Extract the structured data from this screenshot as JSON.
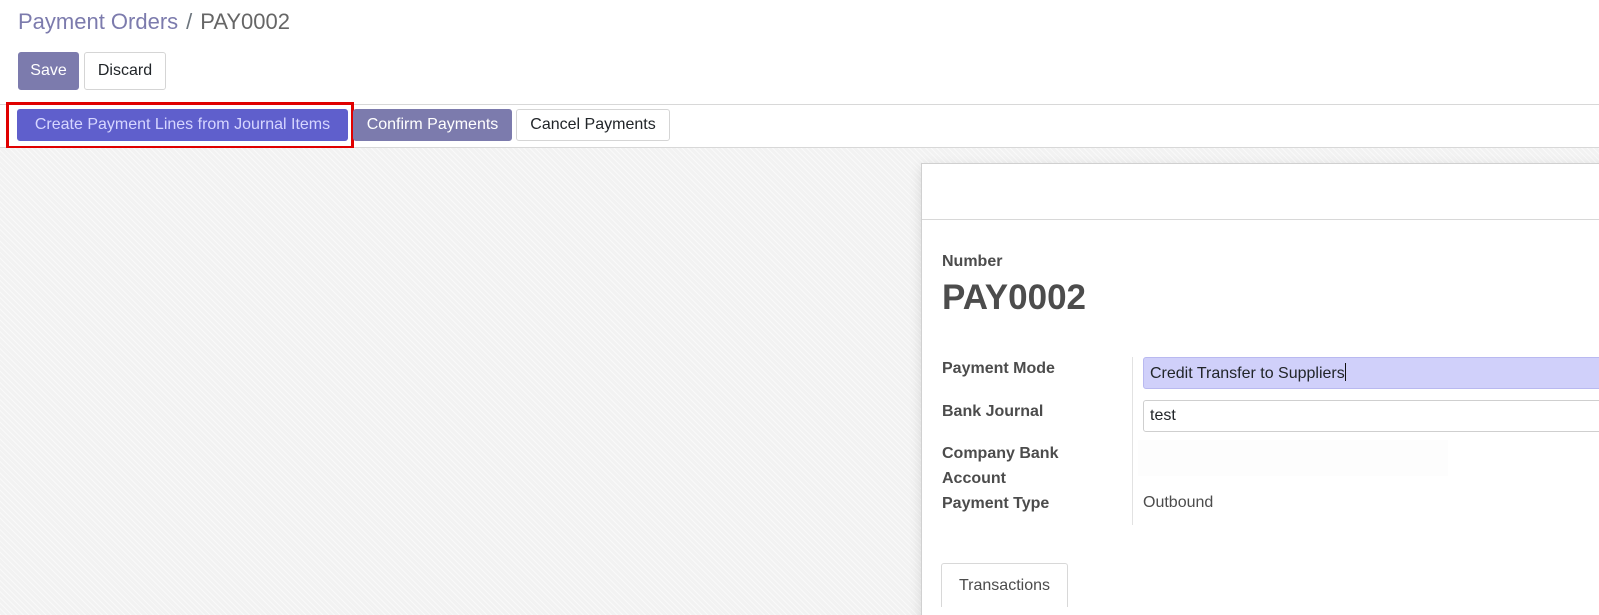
{
  "breadcrumb": {
    "parent": "Payment Orders",
    "separator": "/",
    "current": "PAY0002"
  },
  "toolbar": {
    "save_label": "Save",
    "discard_label": "Discard"
  },
  "statusbar": {
    "create_lines_label": "Create Payment Lines from Journal Items",
    "confirm_label": "Confirm Payments",
    "cancel_label": "Cancel Payments"
  },
  "form": {
    "number_label": "Number",
    "number_value": "PAY0002",
    "payment_mode_label": "Payment Mode",
    "payment_mode_value": "Credit Transfer to Suppliers",
    "bank_journal_label": "Bank Journal",
    "bank_journal_value": "test",
    "company_bank_account_label_line1": "Company Bank",
    "company_bank_account_label_line2": "Account",
    "payment_type_label": "Payment Type",
    "payment_type_value": "Outbound"
  },
  "tabs": [
    {
      "label": "Transactions"
    }
  ],
  "colors": {
    "primary": "#7c7bad",
    "highlight_border": "#e00000",
    "focused_input": "#d0d0fa"
  }
}
